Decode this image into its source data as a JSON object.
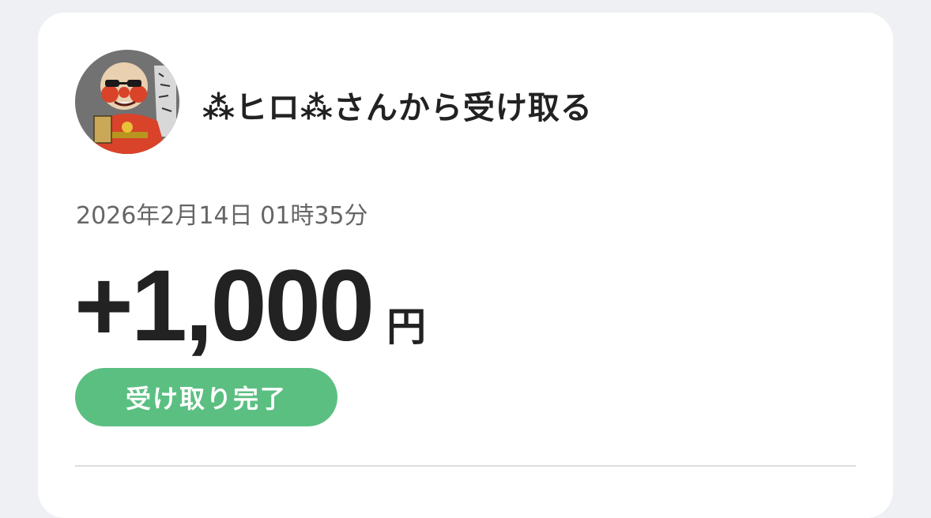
{
  "sender": {
    "text": "⁂ヒロ⁂さんから受け取る"
  },
  "transaction": {
    "datetime": "2026年2月14日 01時35分",
    "amount": "+1,000",
    "currency": "円",
    "status": "受け取り完了"
  },
  "avatar": {
    "icon": "sender-avatar-illustration"
  },
  "colors": {
    "status_green": "#5bbf82",
    "page_background": "#eef0f3",
    "card_background": "#ffffff"
  }
}
